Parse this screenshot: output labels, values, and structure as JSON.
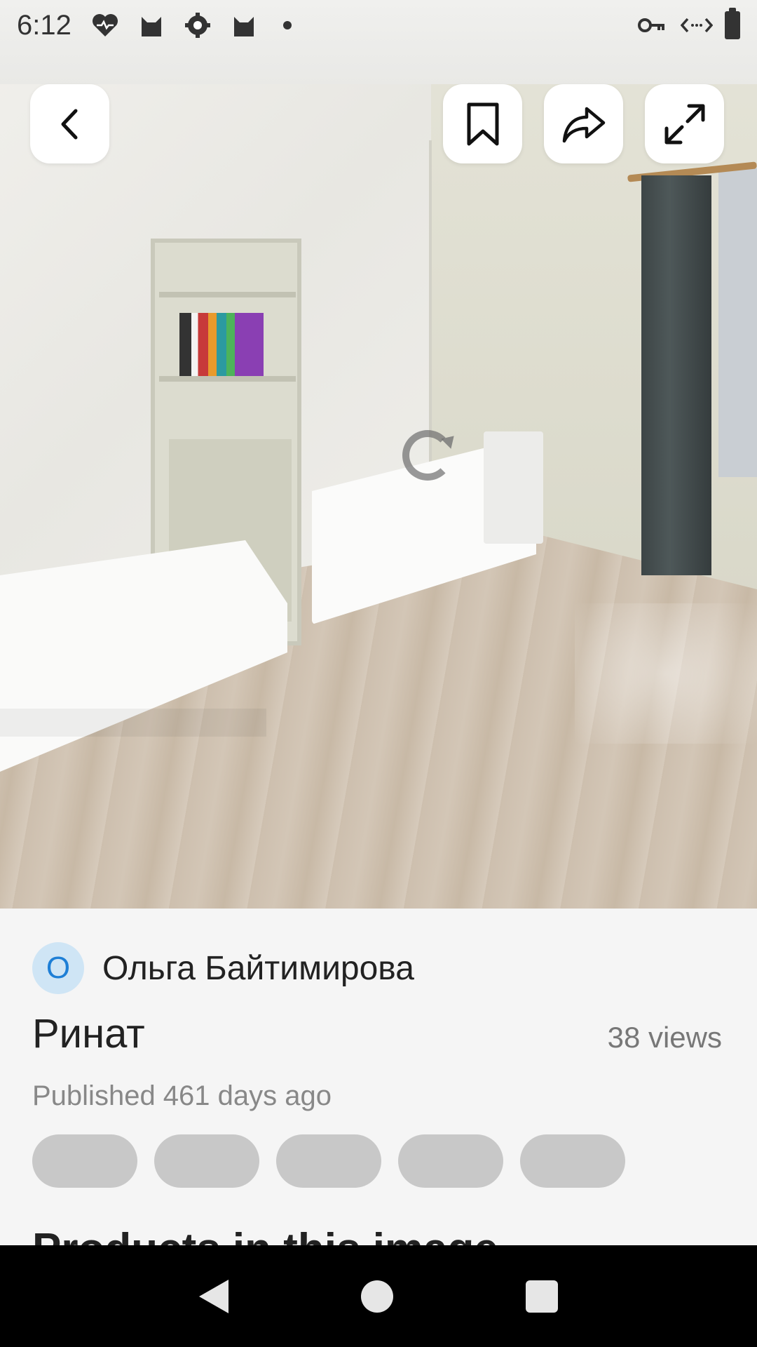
{
  "status_bar": {
    "time": "6:12",
    "left_icons": [
      "heart-pulse-icon",
      "cat-icon",
      "gear-cog-icon",
      "cat-icon",
      "dot-icon"
    ],
    "right_icons": [
      "vpn-key-icon",
      "data-transfer-icon",
      "battery-icon"
    ]
  },
  "toolbar": {
    "back_icon": "chevron-left-icon",
    "bookmark_icon": "bookmark-icon",
    "share_icon": "share-icon",
    "expand_icon": "expand-icon"
  },
  "image": {
    "loading_icon": "reload-icon"
  },
  "post": {
    "author_initial": "О",
    "author_name": "Ольга Байтимирова",
    "title": "Ринат",
    "views": "38 views",
    "published": "Published 461 days ago",
    "tag_chips_count": 5,
    "section_heading": "Products in this image"
  },
  "nav_bar": {
    "icons": [
      "nav-back-icon",
      "nav-home-icon",
      "nav-recents-icon"
    ]
  }
}
